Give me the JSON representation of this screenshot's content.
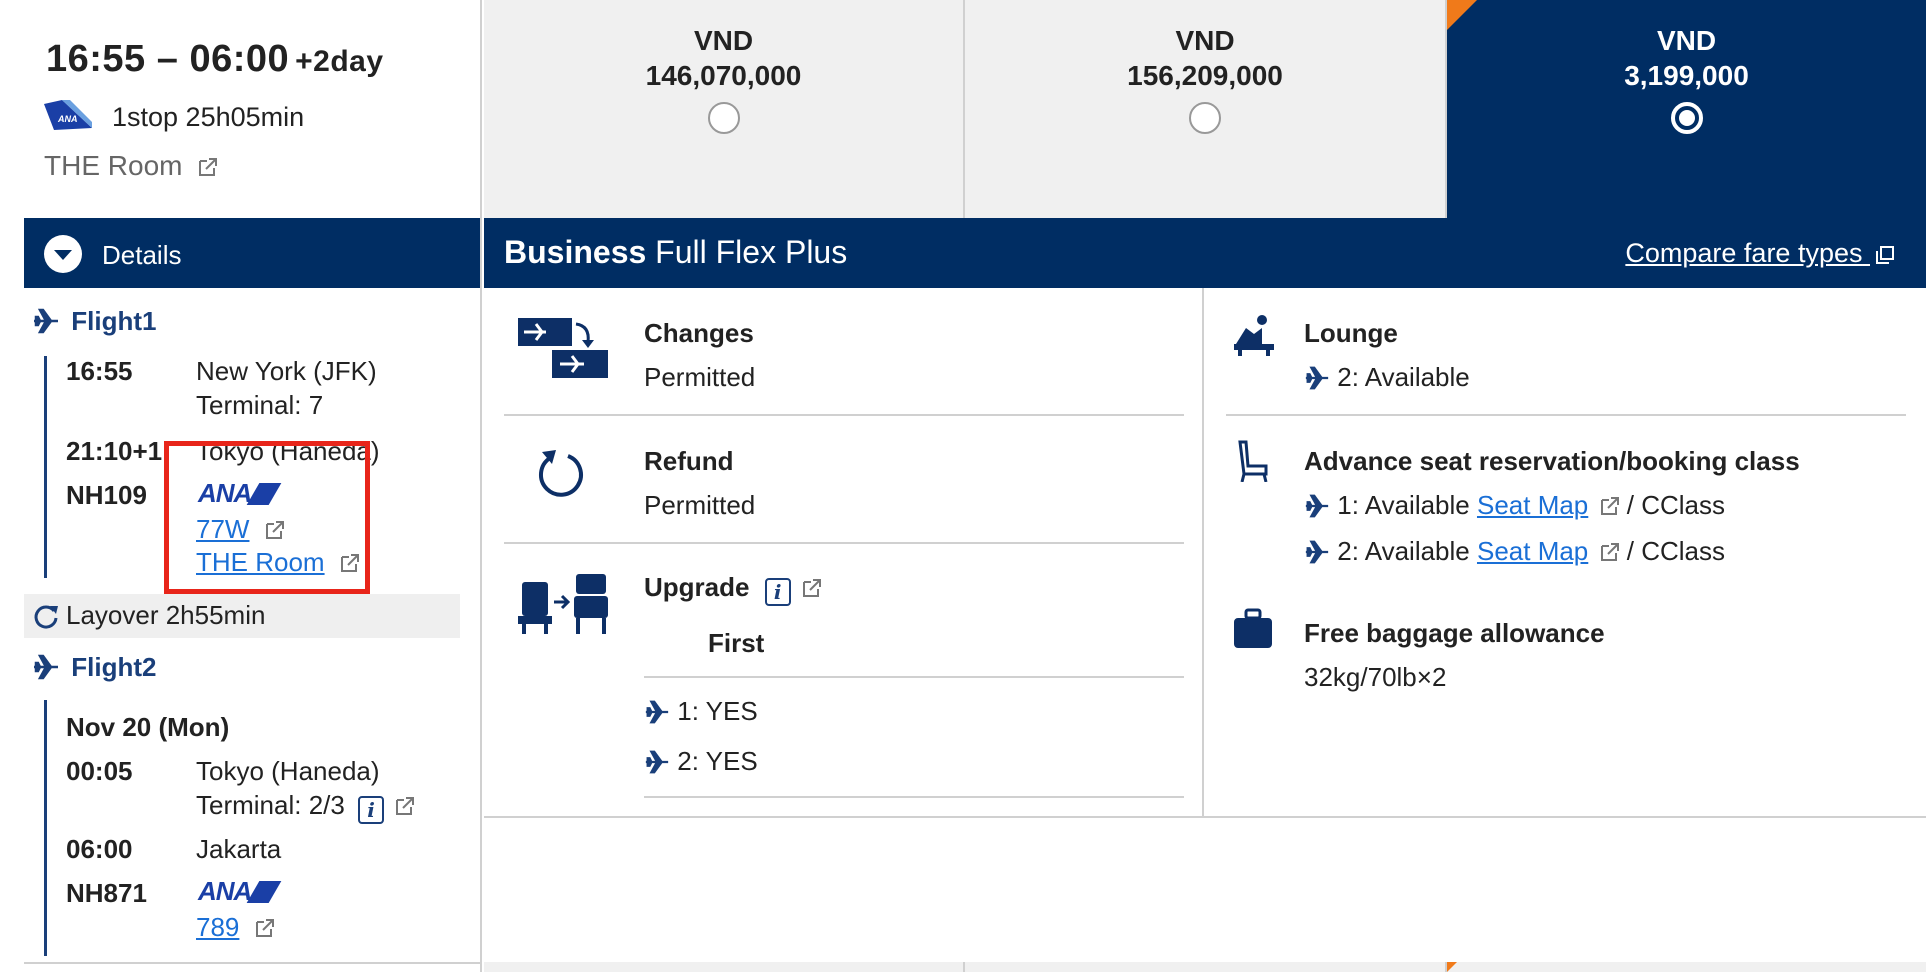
{
  "summary": {
    "time_range": "16:55 – 06:00",
    "plus_day": "+2day",
    "stops": "1stop 25h05min",
    "room_link": "THE Room"
  },
  "fares": [
    {
      "currency": "VND",
      "price": "146,070,000",
      "selected": false
    },
    {
      "currency": "VND",
      "price": "156,209,000",
      "selected": false
    },
    {
      "currency": "VND",
      "price": "3,199,000",
      "selected": true
    }
  ],
  "details_bar": {
    "label": "Details"
  },
  "fare_bar": {
    "cabin": "Business",
    "fare_name": "Full Flex Plus",
    "compare_link": "Compare fare types"
  },
  "itinerary": {
    "flight1": {
      "heading": "Flight1",
      "dep_time": "16:55",
      "dep_city": "New York (JFK)",
      "dep_terminal": "Terminal: 7",
      "arr_time": "21:10+1",
      "arr_city": "Tokyo (Haneda)",
      "flight_no": "NH109",
      "airline_logo": "ANA",
      "aircraft": "77W",
      "room": "THE Room"
    },
    "layover": "Layover 2h55min",
    "flight2": {
      "heading": "Flight2",
      "date": "Nov 20 (Mon)",
      "dep_time": "00:05",
      "dep_city": "Tokyo (Haneda)",
      "dep_terminal": "Terminal: 2/3",
      "arr_time": "06:00",
      "arr_city": "Jakarta",
      "flight_no": "NH871",
      "airline_logo": "ANA",
      "aircraft": "789"
    }
  },
  "features": {
    "changes": {
      "title": "Changes",
      "value": "Permitted"
    },
    "refund": {
      "title": "Refund",
      "value": "Permitted"
    },
    "upgrade": {
      "title": "Upgrade",
      "class": "First",
      "seg1": "1: YES",
      "seg2": "2: YES"
    },
    "lounge": {
      "title": "Lounge",
      "seg2": "2: Available"
    },
    "seat": {
      "title": "Advance seat reservation/booking class",
      "seg1": "1: Available",
      "seg2": "2: Available",
      "seat_map": "Seat Map",
      "cls": "/ CClass"
    },
    "baggage": {
      "title": "Free baggage allowance",
      "value": "32kg/70lb×2"
    }
  },
  "colors": {
    "navy": "#002d63",
    "link": "#1a6fd6",
    "highlight": "#e8251a",
    "accent": "#f07a1a"
  }
}
